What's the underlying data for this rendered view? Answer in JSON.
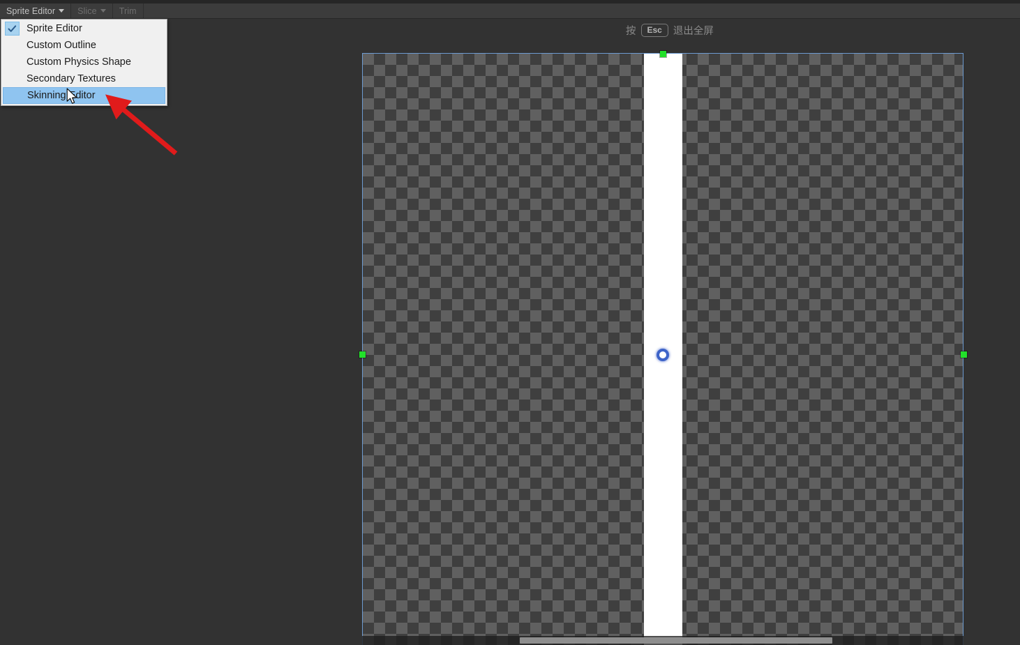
{
  "window": {
    "background_color": "#323232",
    "title": "Sprite Editor"
  },
  "toolbar": {
    "items": [
      {
        "label": "Sprite Editor",
        "has_caret": true,
        "disabled": false,
        "name": "sprite-editor"
      },
      {
        "label": "Slice",
        "has_caret": true,
        "disabled": true,
        "name": "slice"
      },
      {
        "label": "Trim",
        "has_caret": false,
        "disabled": true,
        "name": "trim"
      }
    ]
  },
  "dropdown_menu": {
    "open": true,
    "items": [
      {
        "label": "Sprite Editor",
        "checked": true,
        "highlighted": false
      },
      {
        "label": "Custom Outline",
        "checked": false,
        "highlighted": false
      },
      {
        "label": "Custom Physics Shape",
        "checked": false,
        "highlighted": false
      },
      {
        "label": "Secondary Textures",
        "checked": false,
        "highlighted": false
      },
      {
        "label": "Skinning Editor",
        "checked": false,
        "highlighted": true
      }
    ],
    "highlight_color": "#8fc4f0",
    "background_color": "#f0f0f0"
  },
  "fullscreen_hint": {
    "prefix": "按",
    "key": "Esc",
    "suffix": "退出全屏"
  },
  "canvas": {
    "checker_dark": "#3f3f3f",
    "checker_light": "#606060",
    "border_color": "#6d9bd1",
    "sprite_fill": "#ffffff",
    "handle_color": "#22e02a",
    "pivot_color": "#3d63c8"
  },
  "scrollbar": {
    "orientation": "horizontal",
    "thumb_color": "#8e8e8e"
  },
  "annotation": {
    "arrow_color": "#e01b1b",
    "points_to": "Skinning Editor"
  }
}
